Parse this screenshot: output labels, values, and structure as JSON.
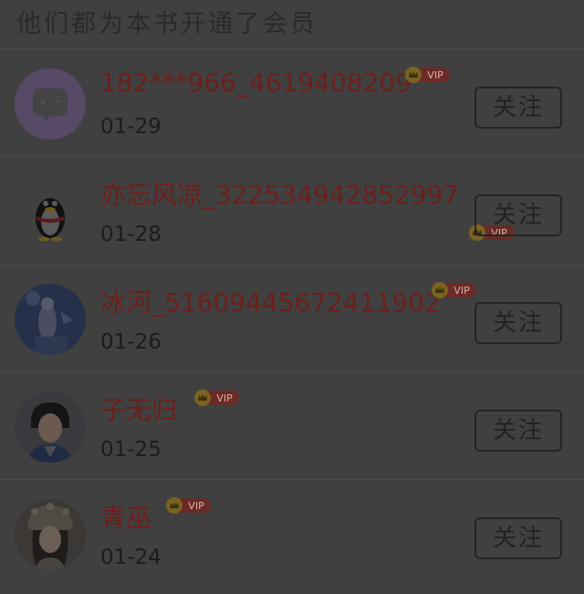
{
  "header": {
    "title": "他们都为本书开通了会员"
  },
  "members": [
    {
      "name": "182***966_4619408209",
      "date": "01-29",
      "badge": "VIP",
      "follow_label": "关注",
      "avatar_icon": "chat-bubble-avatar-icon"
    },
    {
      "name": "亦忘风凉_322534942852997",
      "date": "01-28",
      "badge": "VIP",
      "follow_label": "关注",
      "avatar_icon": "penguin-avatar-icon"
    },
    {
      "name": "冰河_51609445672411902",
      "date": "01-26",
      "badge": "VIP",
      "follow_label": "关注",
      "avatar_icon": "photo-avatar-icon"
    },
    {
      "name": "子无归",
      "date": "01-25",
      "badge": "VIP",
      "follow_label": "关注",
      "avatar_icon": "photo-avatar-icon"
    },
    {
      "name": "青巫",
      "date": "01-24",
      "badge": "VIP",
      "follow_label": "关注",
      "avatar_icon": "photo-avatar-icon"
    }
  ],
  "colors": {
    "overlay_bg": "#404040",
    "name_text": "#6d1f1a",
    "vip_badge": "#6b2a26",
    "crown": "#7a6320"
  }
}
